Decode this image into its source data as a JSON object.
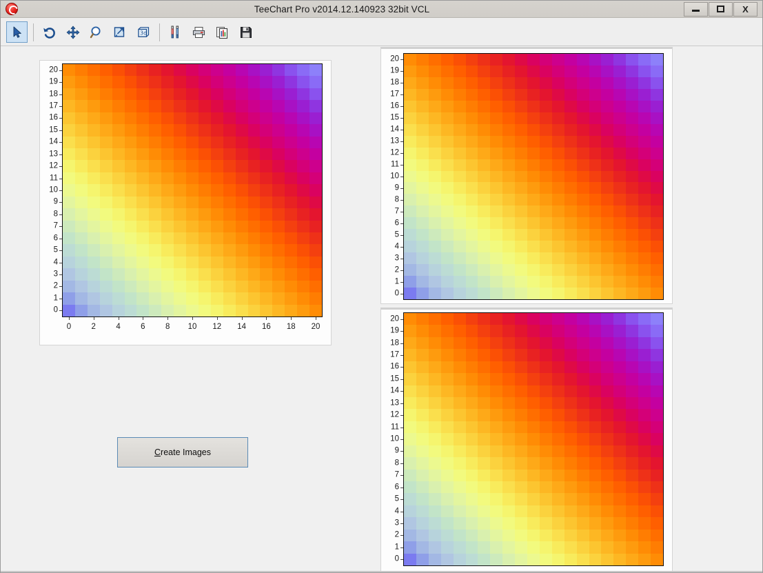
{
  "window": {
    "title": "TeeChart Pro v2014.12.140923 32bit VCL",
    "app_icon": "teechart-logo-icon",
    "controls": {
      "minimize": "minimize-icon",
      "maximize": "maximize-icon",
      "close": "X"
    }
  },
  "toolbar": {
    "items": [
      {
        "name": "select-arrow-tool",
        "icon": "cursor-arrow-icon",
        "active": true
      },
      {
        "name": "undo-tool",
        "icon": "undo-arrow-icon",
        "active": false
      },
      {
        "name": "pan-tool",
        "icon": "move-cross-icon",
        "active": false
      },
      {
        "name": "zoom-tool",
        "icon": "magnifier-icon",
        "active": false
      },
      {
        "name": "normal-view-tool",
        "icon": "chart-2d-icon",
        "active": false
      },
      {
        "name": "rotate-3d-tool",
        "icon": "chart-3d-icon",
        "active": false
      },
      {
        "name": "chart-editor-tool",
        "icon": "tools-wrench-icon",
        "active": false
      },
      {
        "name": "print-tool",
        "icon": "printer-icon",
        "active": false
      },
      {
        "name": "copy-tool",
        "icon": "copy-chart-icon",
        "active": false
      },
      {
        "name": "save-tool",
        "icon": "floppy-save-icon",
        "active": false
      }
    ]
  },
  "actions": {
    "create_images_label": "Create Images",
    "create_images_accel": "C",
    "create_images_rest": "reate Images"
  },
  "chart_data": [
    {
      "id": "chart-main",
      "type": "heatmap",
      "title": "",
      "xlabel": "",
      "ylabel": "",
      "grid": false,
      "legend": false,
      "xlim": [
        0,
        20
      ],
      "ylim": [
        0,
        20
      ],
      "x_ticks": [
        0,
        2,
        4,
        6,
        8,
        10,
        12,
        14,
        16,
        18,
        20
      ],
      "y_ticks": [
        0,
        1,
        2,
        3,
        4,
        5,
        6,
        7,
        8,
        9,
        10,
        11,
        12,
        13,
        14,
        15,
        16,
        17,
        18,
        19,
        20
      ],
      "x_tick_labels": [
        "0",
        "2",
        "4",
        "6",
        "8",
        "10",
        "12",
        "14",
        "16",
        "18",
        "20"
      ],
      "y_tick_labels": [
        "0",
        "1",
        "2",
        "3",
        "4",
        "5",
        "6",
        "7",
        "8",
        "9",
        "10",
        "11",
        "12",
        "13",
        "14",
        "15",
        "16",
        "17",
        "18",
        "19",
        "20"
      ],
      "show_x_labels": true,
      "show_y_labels": true,
      "cols": 21,
      "rows": 21,
      "value_rule": "z = x + y  (range 0..40), rainbow palette blue->green->yellow->orange->red->magenta->violet",
      "palette": [
        "#7b7bf0",
        "#8f9fe8",
        "#a3b8e4",
        "#b0c6e2",
        "#b7d3dc",
        "#bcdcd4",
        "#c2e4c8",
        "#cdeabc",
        "#d9f0ae",
        "#e3f59f",
        "#ecf98f",
        "#f2fa7e",
        "#f5f56e",
        "#f8eb5c",
        "#fadf4d",
        "#fbd23e",
        "#fcc530",
        "#fdb723",
        "#fea918",
        "#fe9b0e",
        "#ff8c05",
        "#ff7d02",
        "#ff6e00",
        "#ff5f00",
        "#fb5005",
        "#f4400f",
        "#ee3118",
        "#e82222",
        "#e4152f",
        "#df0a46",
        "#da0260",
        "#d40078",
        "#cd008d",
        "#c400a0",
        "#b806b2",
        "#a811c4",
        "#9a1fd2",
        "#8f35e0",
        "#8a52ee",
        "#8a6bf6",
        "#8d80fa"
      ]
    },
    {
      "id": "chart-copy-top",
      "type": "heatmap",
      "title": "",
      "xlabel": "",
      "ylabel": "",
      "grid": false,
      "legend": false,
      "xlim": [
        0,
        20
      ],
      "ylim": [
        0,
        20
      ],
      "y_tick_labels": [
        "0",
        "1",
        "2",
        "3",
        "4",
        "5",
        "6",
        "7",
        "8",
        "9",
        "10",
        "11",
        "12",
        "13",
        "14",
        "15",
        "16",
        "17",
        "18",
        "19",
        "20"
      ],
      "show_x_labels": false,
      "show_y_labels": true,
      "cols": 21,
      "rows": 21,
      "value_rule": "z = x + y  (range 0..40), rainbow palette"
    },
    {
      "id": "chart-copy-bottom",
      "type": "heatmap",
      "title": "",
      "xlabel": "",
      "ylabel": "",
      "grid": false,
      "legend": false,
      "xlim": [
        0,
        20
      ],
      "ylim": [
        0,
        20
      ],
      "y_tick_labels": [
        "0",
        "1",
        "2",
        "3",
        "4",
        "5",
        "6",
        "7",
        "8",
        "9",
        "10",
        "11",
        "12",
        "13",
        "14",
        "15",
        "16",
        "17",
        "18",
        "19",
        "20"
      ],
      "show_x_labels": false,
      "show_y_labels": true,
      "cols": 21,
      "rows": 21,
      "value_rule": "z = x + y  (range 0..40), rainbow palette"
    }
  ]
}
